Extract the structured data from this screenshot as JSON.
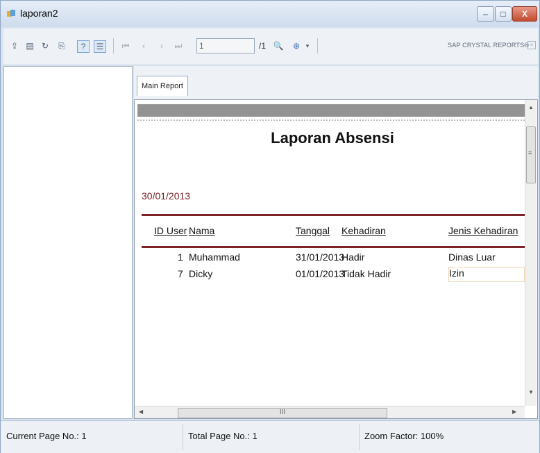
{
  "window": {
    "title": "laporan2",
    "minimize": "–",
    "maximize": "□",
    "close": "X"
  },
  "toolbar": {
    "page_value": "1",
    "page_count": "/1",
    "brand": "SAP CRYSTAL REPORTS®",
    "brand_close": "×",
    "icons": [
      "export",
      "print",
      "refresh",
      "copy",
      "help",
      "group-tree",
      "first-page",
      "previous-page",
      "next-page",
      "last-page",
      "find",
      "zoom"
    ]
  },
  "tab": {
    "label": "Main Report"
  },
  "report": {
    "title": "Laporan Absensi",
    "date": "30/01/2013",
    "columns": [
      "ID User",
      "Nama",
      "Tanggal",
      "Kehadiran",
      "Jenis Kehadiran"
    ],
    "rows": [
      {
        "id": "1",
        "nama": "Muhammad",
        "tanggal": "31/01/2013",
        "kehadiran": "Hadir",
        "jenis": "Dinas Luar"
      },
      {
        "id": "7",
        "nama": "Dicky",
        "tanggal": "01/01/2013",
        "kehadiran": "Tidak Hadir",
        "jenis": "Izin"
      }
    ]
  },
  "scroll": {
    "hthumb": "III",
    "vthumb": "≡"
  },
  "status": {
    "current_page": "Current Page No.: 1",
    "total_page": "Total Page No.: 1",
    "zoom": "Zoom Factor: 100%"
  }
}
